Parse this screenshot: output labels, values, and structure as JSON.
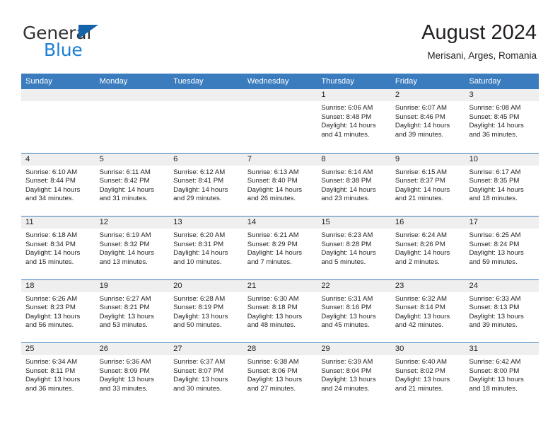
{
  "brand": {
    "name_part1": "General",
    "name_part2": "Blue",
    "accent_color": "#1a7fd4",
    "triangle_color": "#1463a8"
  },
  "header": {
    "title": "August 2024",
    "location": "Merisani, Arges, Romania",
    "header_band_color": "#3a7cbe"
  },
  "weekdays": [
    "Sunday",
    "Monday",
    "Tuesday",
    "Wednesday",
    "Thursday",
    "Friday",
    "Saturday"
  ],
  "weeks": [
    [
      {
        "day": "",
        "empty": true
      },
      {
        "day": "",
        "empty": true
      },
      {
        "day": "",
        "empty": true
      },
      {
        "day": "",
        "empty": true
      },
      {
        "day": "1",
        "sunrise": "Sunrise: 6:06 AM",
        "sunset": "Sunset: 8:48 PM",
        "daylight": "Daylight: 14 hours and 41 minutes."
      },
      {
        "day": "2",
        "sunrise": "Sunrise: 6:07 AM",
        "sunset": "Sunset: 8:46 PM",
        "daylight": "Daylight: 14 hours and 39 minutes."
      },
      {
        "day": "3",
        "sunrise": "Sunrise: 6:08 AM",
        "sunset": "Sunset: 8:45 PM",
        "daylight": "Daylight: 14 hours and 36 minutes."
      }
    ],
    [
      {
        "day": "4",
        "sunrise": "Sunrise: 6:10 AM",
        "sunset": "Sunset: 8:44 PM",
        "daylight": "Daylight: 14 hours and 34 minutes."
      },
      {
        "day": "5",
        "sunrise": "Sunrise: 6:11 AM",
        "sunset": "Sunset: 8:42 PM",
        "daylight": "Daylight: 14 hours and 31 minutes."
      },
      {
        "day": "6",
        "sunrise": "Sunrise: 6:12 AM",
        "sunset": "Sunset: 8:41 PM",
        "daylight": "Daylight: 14 hours and 29 minutes."
      },
      {
        "day": "7",
        "sunrise": "Sunrise: 6:13 AM",
        "sunset": "Sunset: 8:40 PM",
        "daylight": "Daylight: 14 hours and 26 minutes."
      },
      {
        "day": "8",
        "sunrise": "Sunrise: 6:14 AM",
        "sunset": "Sunset: 8:38 PM",
        "daylight": "Daylight: 14 hours and 23 minutes."
      },
      {
        "day": "9",
        "sunrise": "Sunrise: 6:15 AM",
        "sunset": "Sunset: 8:37 PM",
        "daylight": "Daylight: 14 hours and 21 minutes."
      },
      {
        "day": "10",
        "sunrise": "Sunrise: 6:17 AM",
        "sunset": "Sunset: 8:35 PM",
        "daylight": "Daylight: 14 hours and 18 minutes."
      }
    ],
    [
      {
        "day": "11",
        "sunrise": "Sunrise: 6:18 AM",
        "sunset": "Sunset: 8:34 PM",
        "daylight": "Daylight: 14 hours and 15 minutes."
      },
      {
        "day": "12",
        "sunrise": "Sunrise: 6:19 AM",
        "sunset": "Sunset: 8:32 PM",
        "daylight": "Daylight: 14 hours and 13 minutes."
      },
      {
        "day": "13",
        "sunrise": "Sunrise: 6:20 AM",
        "sunset": "Sunset: 8:31 PM",
        "daylight": "Daylight: 14 hours and 10 minutes."
      },
      {
        "day": "14",
        "sunrise": "Sunrise: 6:21 AM",
        "sunset": "Sunset: 8:29 PM",
        "daylight": "Daylight: 14 hours and 7 minutes."
      },
      {
        "day": "15",
        "sunrise": "Sunrise: 6:23 AM",
        "sunset": "Sunset: 8:28 PM",
        "daylight": "Daylight: 14 hours and 5 minutes."
      },
      {
        "day": "16",
        "sunrise": "Sunrise: 6:24 AM",
        "sunset": "Sunset: 8:26 PM",
        "daylight": "Daylight: 14 hours and 2 minutes."
      },
      {
        "day": "17",
        "sunrise": "Sunrise: 6:25 AM",
        "sunset": "Sunset: 8:24 PM",
        "daylight": "Daylight: 13 hours and 59 minutes."
      }
    ],
    [
      {
        "day": "18",
        "sunrise": "Sunrise: 6:26 AM",
        "sunset": "Sunset: 8:23 PM",
        "daylight": "Daylight: 13 hours and 56 minutes."
      },
      {
        "day": "19",
        "sunrise": "Sunrise: 6:27 AM",
        "sunset": "Sunset: 8:21 PM",
        "daylight": "Daylight: 13 hours and 53 minutes."
      },
      {
        "day": "20",
        "sunrise": "Sunrise: 6:28 AM",
        "sunset": "Sunset: 8:19 PM",
        "daylight": "Daylight: 13 hours and 50 minutes."
      },
      {
        "day": "21",
        "sunrise": "Sunrise: 6:30 AM",
        "sunset": "Sunset: 8:18 PM",
        "daylight": "Daylight: 13 hours and 48 minutes."
      },
      {
        "day": "22",
        "sunrise": "Sunrise: 6:31 AM",
        "sunset": "Sunset: 8:16 PM",
        "daylight": "Daylight: 13 hours and 45 minutes."
      },
      {
        "day": "23",
        "sunrise": "Sunrise: 6:32 AM",
        "sunset": "Sunset: 8:14 PM",
        "daylight": "Daylight: 13 hours and 42 minutes."
      },
      {
        "day": "24",
        "sunrise": "Sunrise: 6:33 AM",
        "sunset": "Sunset: 8:13 PM",
        "daylight": "Daylight: 13 hours and 39 minutes."
      }
    ],
    [
      {
        "day": "25",
        "sunrise": "Sunrise: 6:34 AM",
        "sunset": "Sunset: 8:11 PM",
        "daylight": "Daylight: 13 hours and 36 minutes."
      },
      {
        "day": "26",
        "sunrise": "Sunrise: 6:36 AM",
        "sunset": "Sunset: 8:09 PM",
        "daylight": "Daylight: 13 hours and 33 minutes."
      },
      {
        "day": "27",
        "sunrise": "Sunrise: 6:37 AM",
        "sunset": "Sunset: 8:07 PM",
        "daylight": "Daylight: 13 hours and 30 minutes."
      },
      {
        "day": "28",
        "sunrise": "Sunrise: 6:38 AM",
        "sunset": "Sunset: 8:06 PM",
        "daylight": "Daylight: 13 hours and 27 minutes."
      },
      {
        "day": "29",
        "sunrise": "Sunrise: 6:39 AM",
        "sunset": "Sunset: 8:04 PM",
        "daylight": "Daylight: 13 hours and 24 minutes."
      },
      {
        "day": "30",
        "sunrise": "Sunrise: 6:40 AM",
        "sunset": "Sunset: 8:02 PM",
        "daylight": "Daylight: 13 hours and 21 minutes."
      },
      {
        "day": "31",
        "sunrise": "Sunrise: 6:42 AM",
        "sunset": "Sunset: 8:00 PM",
        "daylight": "Daylight: 13 hours and 18 minutes."
      }
    ]
  ]
}
